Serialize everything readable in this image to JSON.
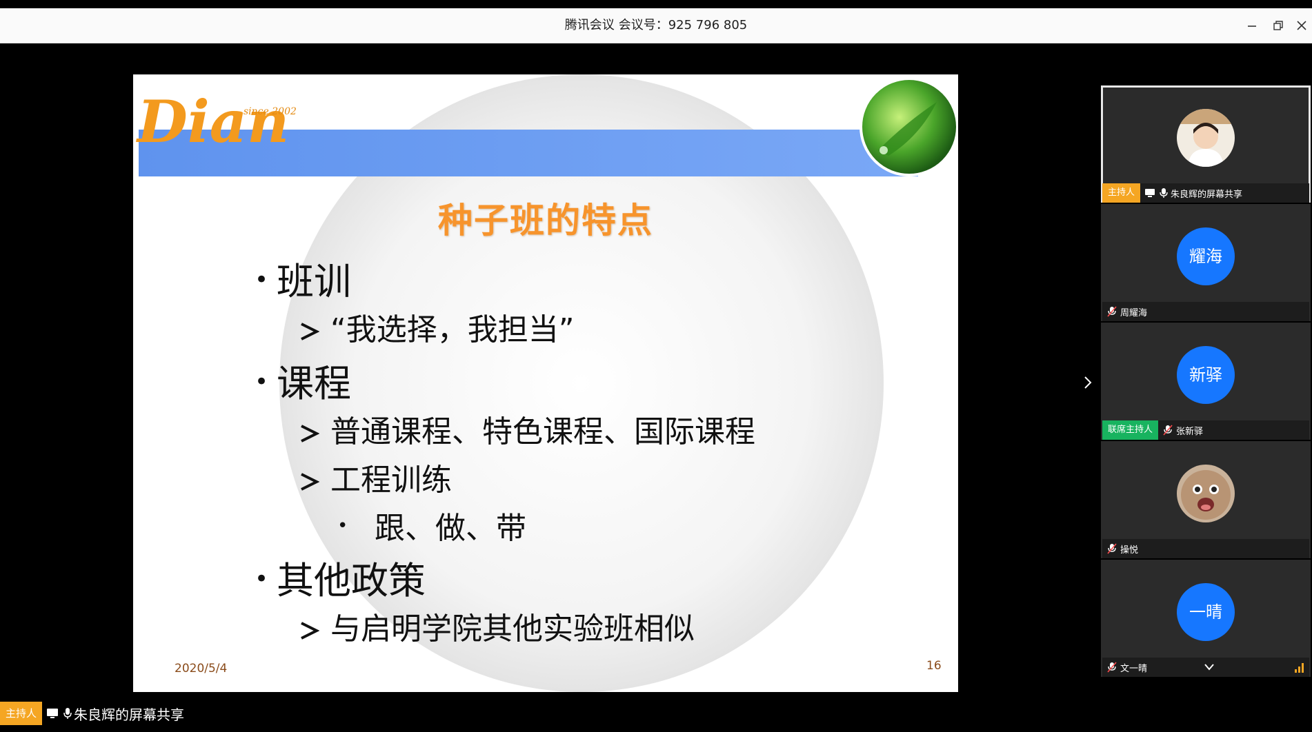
{
  "window": {
    "app_name": "腾讯会议",
    "meeting_label": "会议号：925 796 805"
  },
  "slide": {
    "logo_text": "Dian",
    "logo_since": "since 2002",
    "title": "种子班的特点",
    "items": [
      {
        "level": 1,
        "text": "班训"
      },
      {
        "level": 2,
        "text": "“我选择，我担当”"
      },
      {
        "level": 1,
        "text": "课程"
      },
      {
        "level": 2,
        "text": "普通课程、特色课程、国际课程"
      },
      {
        "level": 2,
        "text": "工程训练"
      },
      {
        "level": 3,
        "text": "跟、做、带"
      },
      {
        "level": 1,
        "text": "其他政策"
      },
      {
        "level": 2,
        "text": "与启明学院其他实验班相似"
      }
    ],
    "date": "2020/5/4",
    "page_number": "16"
  },
  "share_banner": {
    "host_badge": "主持人",
    "name": "朱良辉的屏幕共享"
  },
  "participants": [
    {
      "name": "朱良辉的屏幕共享",
      "badge": "主持人",
      "avatar_type": "photo",
      "avatar_text": "",
      "active": true
    },
    {
      "name": "周耀海",
      "badge": "",
      "avatar_type": "circle",
      "avatar_text": "耀海",
      "active": false
    },
    {
      "name": "张新驿",
      "badge": "联席主持人",
      "avatar_type": "circle",
      "avatar_text": "新驿",
      "active": false
    },
    {
      "name": "操悦",
      "badge": "",
      "avatar_type": "photo",
      "avatar_text": "",
      "active": false
    },
    {
      "name": "文一晴",
      "badge": "",
      "avatar_type": "circle",
      "avatar_text": "一晴",
      "active": false
    }
  ],
  "colors": {
    "accent_blue": "#1677ff",
    "host_orange": "#f5a623",
    "cohost_green": "#18b35f",
    "slide_title_orange": "#f7942c"
  }
}
